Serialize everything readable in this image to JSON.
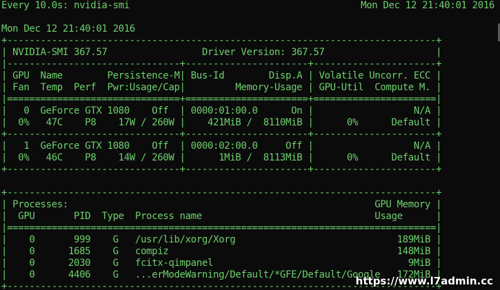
{
  "colors": {
    "foreground": "#6fd06f",
    "background": "#0b0b0b",
    "watermark": "#ffffff"
  },
  "header": {
    "command": "Every 10.0s: nvidia-smi",
    "clock": "Mon Dec 12 21:40:01 2016"
  },
  "output_lines": [
    "",
    "Mon Dec 12 21:40:01 2016",
    "+-----------------------------------------------------------------------------+",
    "| NVIDIA-SMI 367.57                 Driver Version: 367.57                    |",
    "|-------------------------------+----------------------+----------------------+",
    "| GPU  Name        Persistence-M| Bus-Id        Disp.A | Volatile Uncorr. ECC |",
    "| Fan  Temp  Perf  Pwr:Usage/Cap|         Memory-Usage | GPU-Util  Compute M. |",
    "|===============================+======================+======================|",
    "|   0  GeForce GTX 1080    Off  | 0000:01:00.0      On |                  N/A |",
    "|  0%   47C    P8    17W / 260W |    421MiB /  8110MiB |      0%      Default |",
    "+-------------------------------+----------------------+----------------------+",
    "|   1  GeForce GTX 1080    Off  | 0000:02:00.0     Off |                  N/A |",
    "|  0%   46C    P8    14W / 260W |      1MiB /  8113MiB |      0%      Default |",
    "+-------------------------------+----------------------+----------------------+",
    "",
    "+-----------------------------------------------------------------------------+",
    "| Processes:                                                       GPU Memory |",
    "|  GPU       PID  Type  Process name                               Usage      |",
    "|=============================================================================|",
    "|    0       999    G   /usr/lib/xorg/Xorg                             189MiB |",
    "|    0      1685    G   compiz                                         148MiB |",
    "|    0      2030    G   fcitx-qimpanel                                   9MiB |",
    "|    0      4406    G   ...erModeWarning/Default/*GFE/Default/Google   172MiB |",
    "+-----------------------------------------------------------------------------+"
  ],
  "watermark": {
    "text": "https://www.l7admin.cc"
  }
}
